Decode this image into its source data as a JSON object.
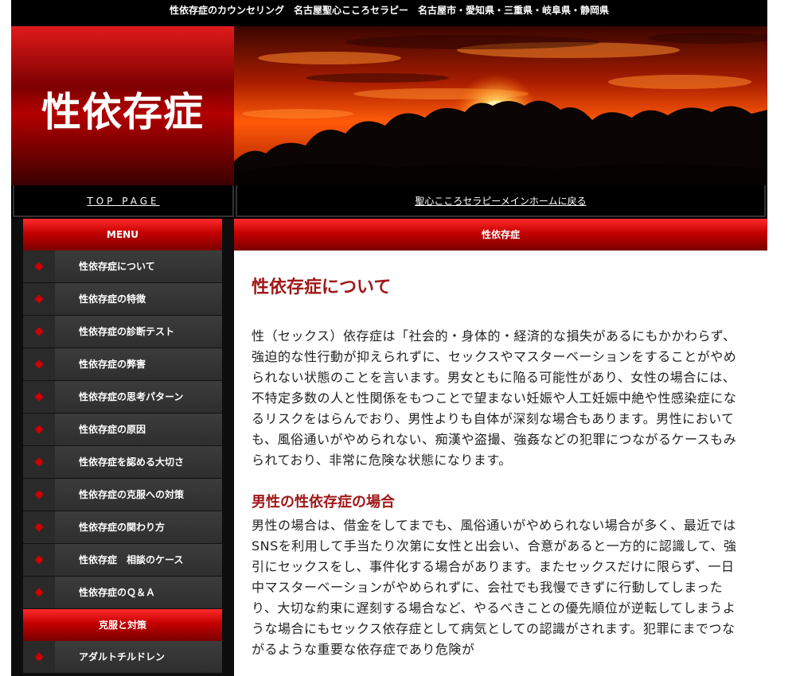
{
  "header": {
    "tagline": "性依存症のカウンセリング　名古屋聖心こころセラピー　名古屋市・愛知県・三重県・岐阜県・静岡県",
    "logo_text": "性依存症"
  },
  "nav": {
    "top_page": "TOP PAGE",
    "main_home": "聖心こころセラピーメインホームに戻る"
  },
  "sidebar": {
    "menu_title": "MENU",
    "items": [
      {
        "label": "性依存症について"
      },
      {
        "label": "性依存症の特徴"
      },
      {
        "label": "性依存症の診断テスト"
      },
      {
        "label": "性依存症の弊害"
      },
      {
        "label": "性依存症の思考パターン"
      },
      {
        "label": "性依存症の原因"
      },
      {
        "label": "性依存症を認める大切さ"
      },
      {
        "label": "性依存症の克服への対策"
      },
      {
        "label": "性依存症の関わり方"
      },
      {
        "label": "性依存症　相談のケース"
      },
      {
        "label": "性依存症のＱ＆Ａ"
      }
    ],
    "section2_title": "克服と対策",
    "items2": [
      {
        "label": "アダルトチルドレン"
      }
    ]
  },
  "content": {
    "bar_title": "性依存症",
    "heading": "性依存症について",
    "paragraph1": "性（セックス）依存症は「社会的・身体的・経済的な損失があるにもかかわらず、強迫的な性行動が抑えられずに、セックスやマスターベーションをすることがやめられない状態のことを言います。男女ともに陥る可能性があり、女性の場合には、不特定多数の人と性関係をもつことで望まない妊娠や人工妊娠中絶や性感染症になるリスクをはらんでおり、男性よりも自体が深刻な場合もあります。男性においても、風俗通いがやめられない、痴漢や盗撮、強姦などの犯罪につながるケースもみられており、非常に危険な状態になります。",
    "subheading": "男性の性依存症の場合",
    "paragraph2": "男性の場合は、借金をしてまでも、風俗通いがやめられない場合が多く、最近ではSNSを利用して手当たり次第に女性と出会い、合意があると一方的に認識して、強引にセックスをし、事件化する場合があります。またセックスだけに限らず、一日中マスターベーションがやめられずに、会社でも我慢できずに行動してしまったり、大切な約束に遅刻する場合など、やるべきことの優先順位が逆転してしまうような場合にもセックス依存症として病気としての認識がされます。犯罪にまでつながるような重要な依存症であり危険が"
  },
  "colors": {
    "accent": "#a01818",
    "bar_red": "#c40000",
    "sidebar_bg": "#0d0d0d"
  }
}
